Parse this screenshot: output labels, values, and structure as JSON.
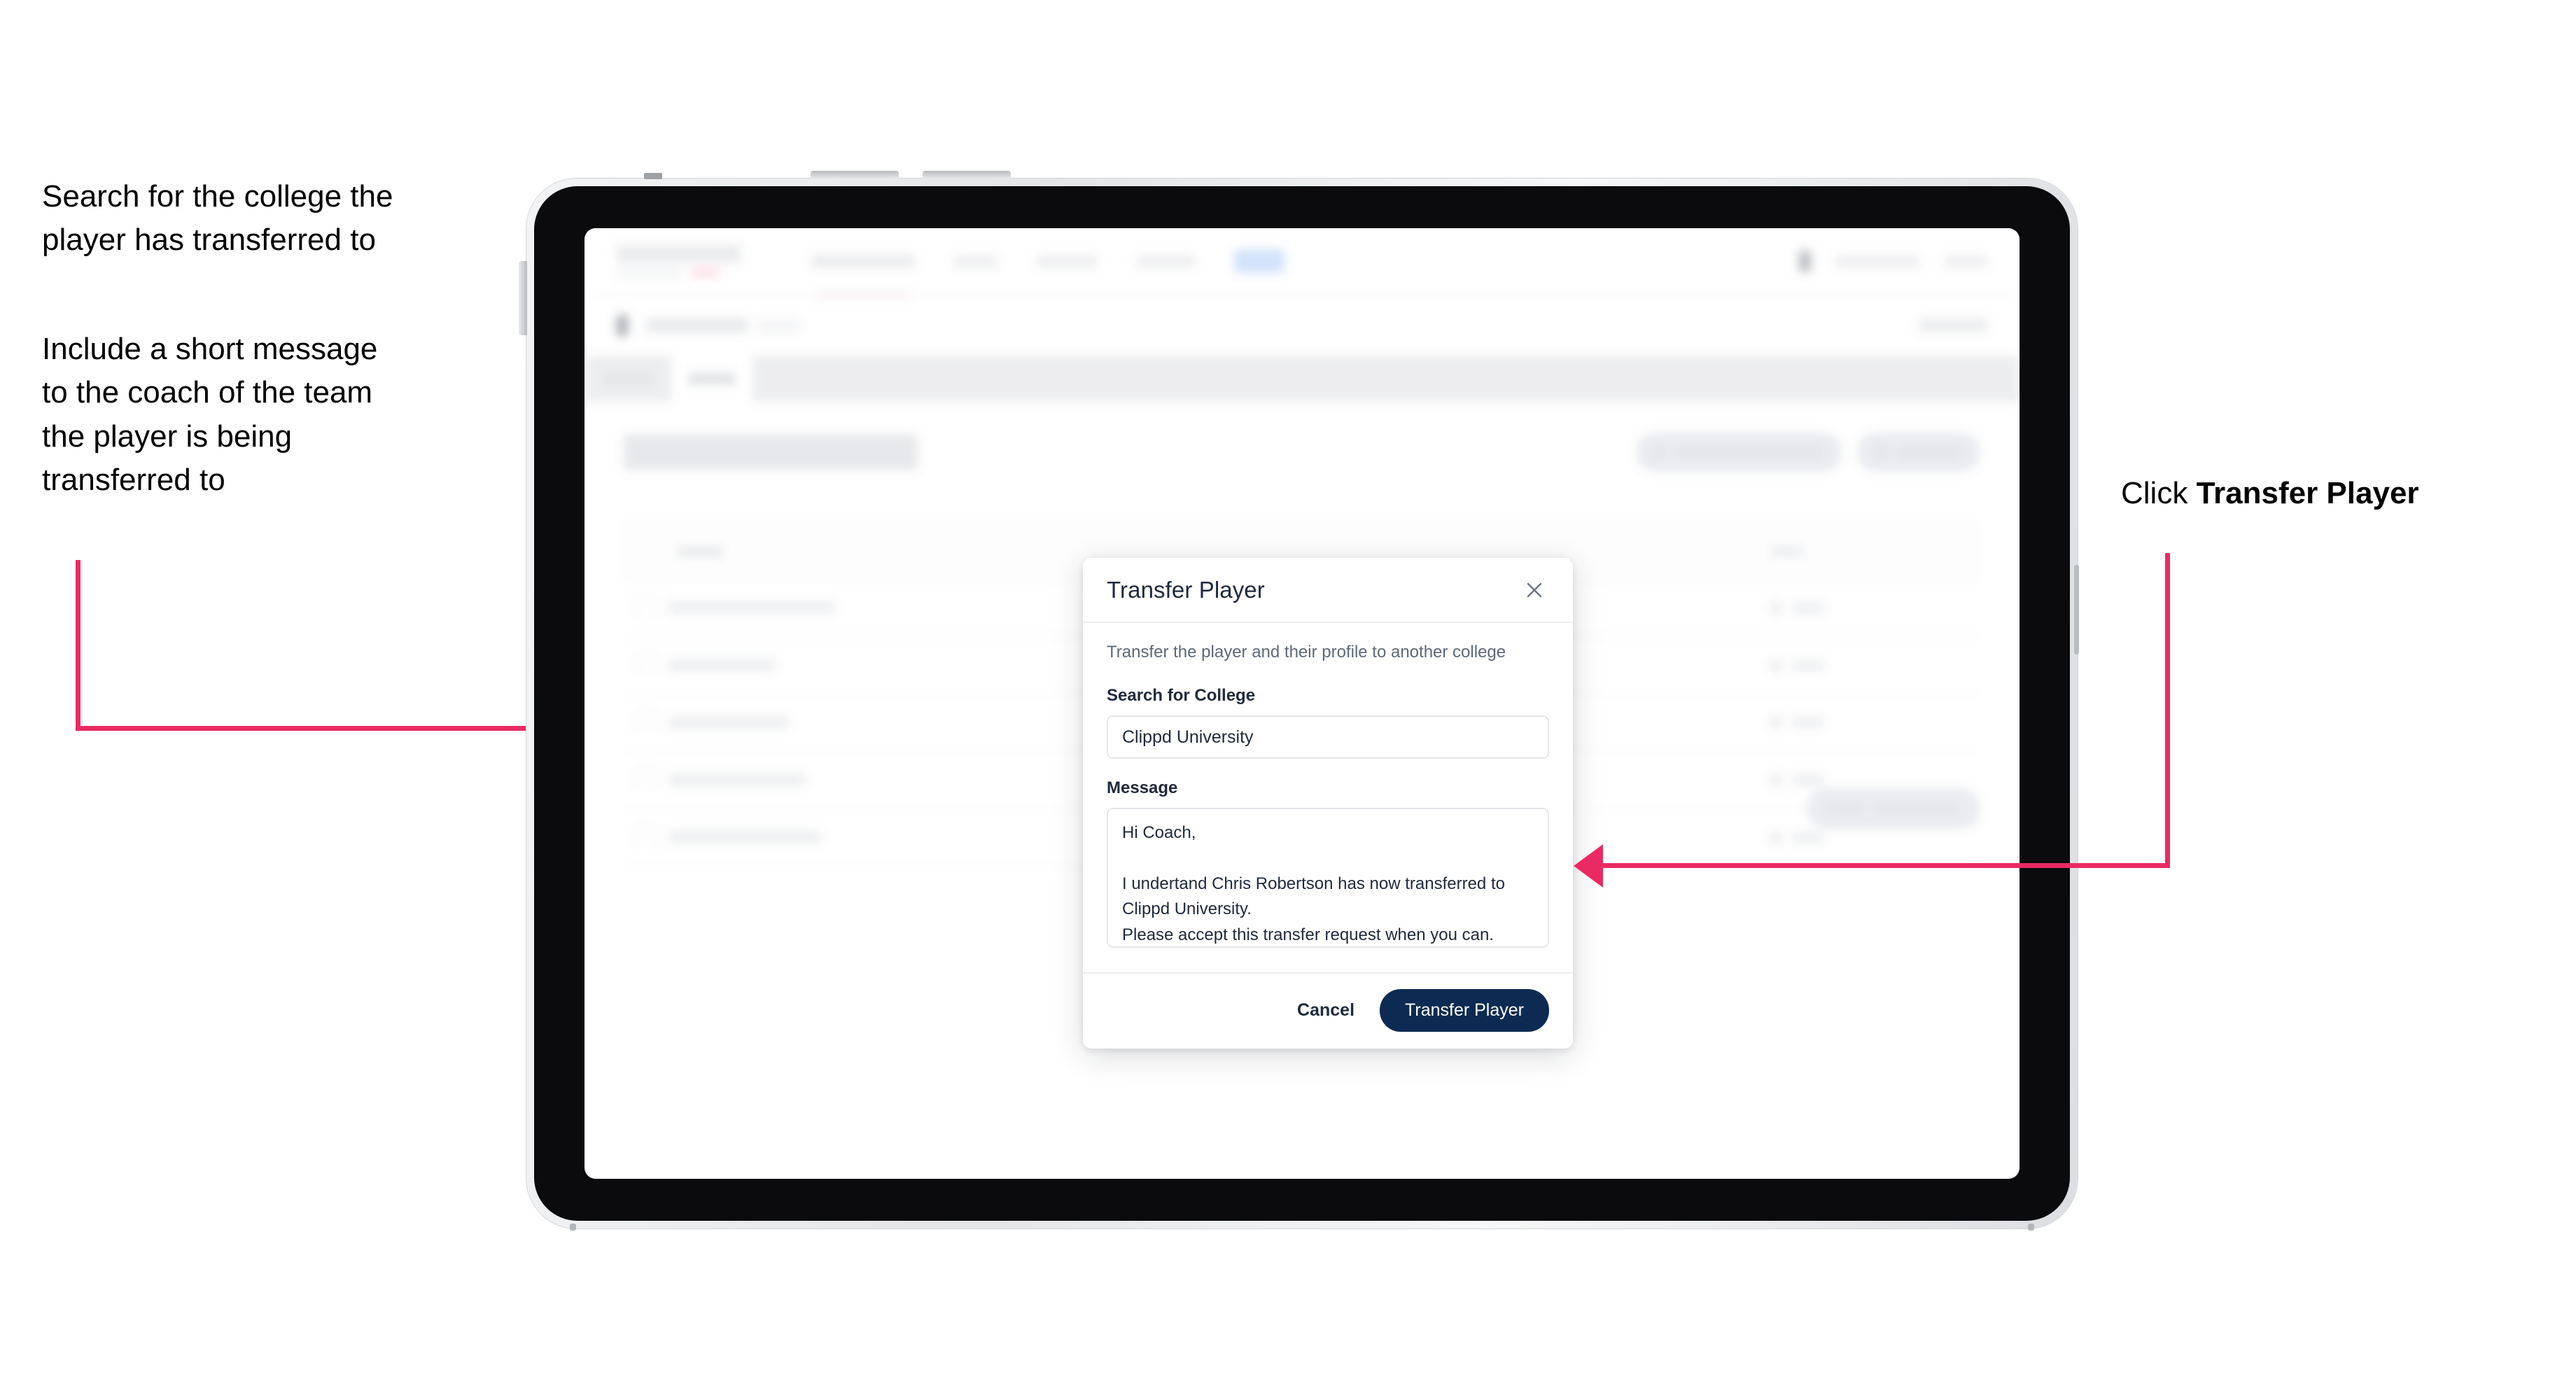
{
  "annotations": {
    "left_note_1": "Search for the college the\nplayer has transferred to",
    "left_note_2": "Include a short message\nto the coach of the team\nthe player is being\ntransferred to",
    "right_note_prefix": "Click ",
    "right_note_bold": "Transfer Player",
    "arrow_color": "#ea2a63"
  },
  "app": {
    "navbar": {
      "logo": "logo-scoreboard",
      "links": [
        "tournaments",
        "teams",
        "leaderboard",
        "analytics"
      ],
      "cta": "nav-cta-button",
      "avatar": "user-avatar",
      "user": "user-email",
      "sign_out": "sign-out-link"
    },
    "breadcrumb": {
      "icon": "back-icon",
      "primary": "breadcrumb-primary",
      "secondary": "breadcrumb-secondary",
      "cancel": "cancel-link"
    },
    "tabs": [
      {
        "name": "tab-details",
        "active": false
      },
      {
        "name": "tab-roster",
        "active": true
      }
    ],
    "page_title": "Update Roster",
    "top_actions": [
      {
        "name": "request-player-transfer-button"
      },
      {
        "name": "add-player-button"
      }
    ],
    "table": {
      "columns": [
        "Name",
        "Edit"
      ],
      "rows": [
        {
          "name": "Chris Robertson",
          "action": "Edit"
        },
        {
          "name": "Ian Waters",
          "action": "Edit"
        },
        {
          "name": "John Taylor",
          "action": "Edit"
        },
        {
          "name": "Lewis Barnes",
          "action": "Edit"
        },
        {
          "name": "Nathan Holmes",
          "action": "Edit"
        }
      ]
    },
    "bottom_cta": {
      "name": "save-roster-changes-button"
    }
  },
  "modal": {
    "title": "Transfer Player",
    "close_icon": "close-icon",
    "subtitle": "Transfer the player and their profile to another college",
    "college_field": {
      "label": "Search for College",
      "value": "Clippd University",
      "placeholder": "Search for College"
    },
    "message_field": {
      "label": "Message",
      "value": "Hi Coach,\n\nI undertand Chris Robertson has now transferred to Clippd University.\nPlease accept this transfer request when you can.",
      "placeholder": "Message"
    },
    "cancel_label": "Cancel",
    "submit_label": "Transfer Player",
    "submit_color": "#0d2b52"
  }
}
